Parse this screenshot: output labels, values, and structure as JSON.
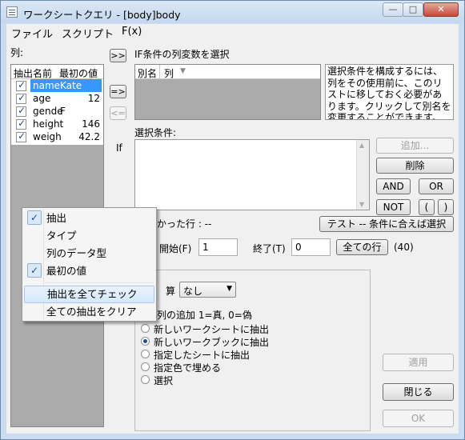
{
  "window": {
    "title": "ワークシートクエリ - [body]body",
    "buttons": {
      "minimize": "—",
      "maximize": "□",
      "close": "✕"
    }
  },
  "menu": [
    "ファイル",
    "スクリプト",
    "F(x)"
  ],
  "columns_panel": {
    "label": "列:",
    "headers": [
      "抽出",
      "名前",
      "最初の値"
    ],
    "rows": [
      {
        "checked": true,
        "name": "name",
        "first_value": "Kate",
        "selected": true
      },
      {
        "checked": true,
        "name": "age",
        "first_value": "12"
      },
      {
        "checked": true,
        "name": "gende",
        "first_value": "F"
      },
      {
        "checked": true,
        "name": "height",
        "first_value": "146"
      },
      {
        "checked": true,
        "name": "weigh",
        "first_value": "42.2"
      }
    ]
  },
  "arrows": {
    "move_all": ">>",
    "move_one": "=>",
    "move_back": "<="
  },
  "if_section": {
    "label": "IF条件の列変数を選択",
    "alias_headers": [
      "別名",
      "列"
    ],
    "help_text": "選択条件を構成するには、列をその使用前に、このリストに移しておく必要があります。クリックして別名を変更することができます。"
  },
  "condition": {
    "label": "選択条件:",
    "if_label": "If",
    "buttons": {
      "add": "追加...",
      "delete": "削除",
      "and": "AND",
      "or": "OR",
      "not": "NOT",
      "paren_open": "(",
      "paren_close": ")"
    }
  },
  "found": {
    "label": "かった行 : --",
    "test_button": "テスト -- 条件に合えば選択"
  },
  "range": {
    "start_label": "開始(F)",
    "start_value": "1",
    "end_label": "終了(T)",
    "end_value": "0",
    "all_rows_button": "全ての行",
    "count": "(40)"
  },
  "output": {
    "calc_label": "算",
    "calc_value": "なし",
    "add_column_label": "列の追加 1=真, 0=偽",
    "options": [
      {
        "label": "新しいワークシートに抽出",
        "selected": false
      },
      {
        "label": "新しいワークブックに抽出",
        "selected": true
      },
      {
        "label": "指定したシートに抽出",
        "selected": false
      },
      {
        "label": "指定色で埋める",
        "selected": false
      },
      {
        "label": "選択",
        "selected": false
      }
    ]
  },
  "actions": {
    "apply": "適用",
    "close": "閉じる",
    "ok": "OK"
  },
  "context_menu": {
    "items": [
      {
        "label": "抽出",
        "checked": true
      },
      {
        "label": "タイプ",
        "checked": false
      },
      {
        "label": "列のデータ型",
        "checked": false
      },
      {
        "label": "最初の値",
        "checked": true
      },
      {
        "label": "抽出を全てチェック",
        "checked": false,
        "highlighted": true
      },
      {
        "label": "全ての抽出をクリア",
        "checked": false
      }
    ]
  }
}
